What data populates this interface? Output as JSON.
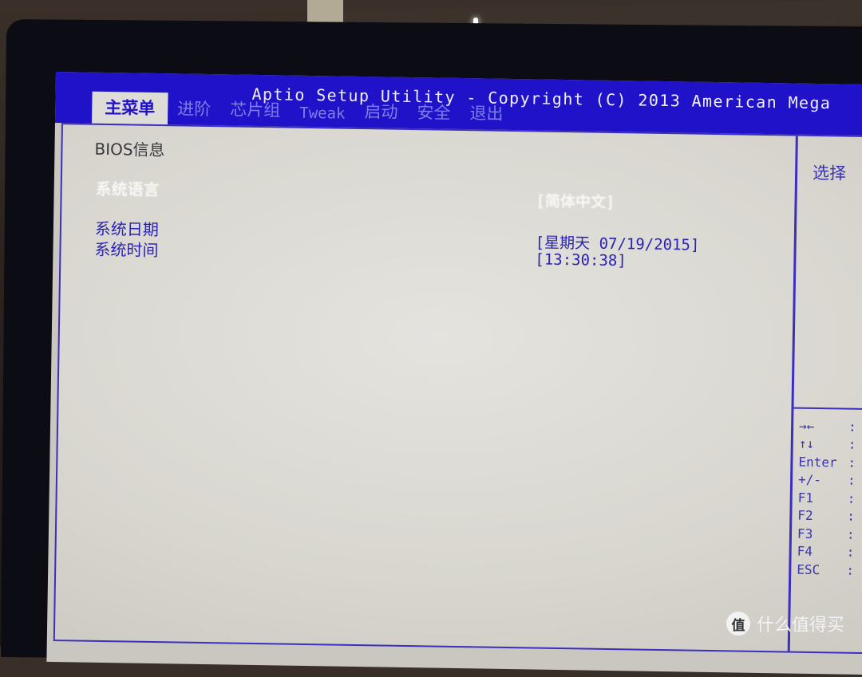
{
  "header": {
    "title": "Aptio Setup Utility - Copyright (C) 2013 American Mega",
    "tabs": [
      {
        "label": "主菜单",
        "active": true
      },
      {
        "label": "进阶",
        "active": false
      },
      {
        "label": "芯片组",
        "active": false
      },
      {
        "label": "Tweak",
        "active": false
      },
      {
        "label": "启动",
        "active": false
      },
      {
        "label": "安全",
        "active": false
      },
      {
        "label": "退出",
        "active": false
      }
    ]
  },
  "main": {
    "section_title": "BIOS信息",
    "items": [
      {
        "label": "系统语言",
        "value": "[简体中文]",
        "selected": true
      },
      {
        "label": "系统日期",
        "value": "[星期天 07/19/2015]",
        "selected": false
      },
      {
        "label": "系统时间",
        "value": "[13:30:38]",
        "selected": false
      }
    ]
  },
  "help_panel": {
    "title": "选择",
    "keys": [
      {
        "key": "→←",
        "icon": "left-right-arrows-icon"
      },
      {
        "key": "↑↓",
        "icon": "up-down-arrows-icon"
      },
      {
        "key": "Enter"
      },
      {
        "key": "+/-"
      },
      {
        "key": "F1"
      },
      {
        "key": "F2"
      },
      {
        "key": "F3"
      },
      {
        "key": "F4"
      },
      {
        "key": "ESC"
      }
    ],
    "separator": ":"
  },
  "watermark": {
    "logo_char": "值",
    "text": "什么值得买"
  },
  "colors": {
    "header_blue": "#1f12c9",
    "text_blue": "#2a22b4",
    "panel_bg": "#dedcd6",
    "selected_text": "#ffffff"
  }
}
